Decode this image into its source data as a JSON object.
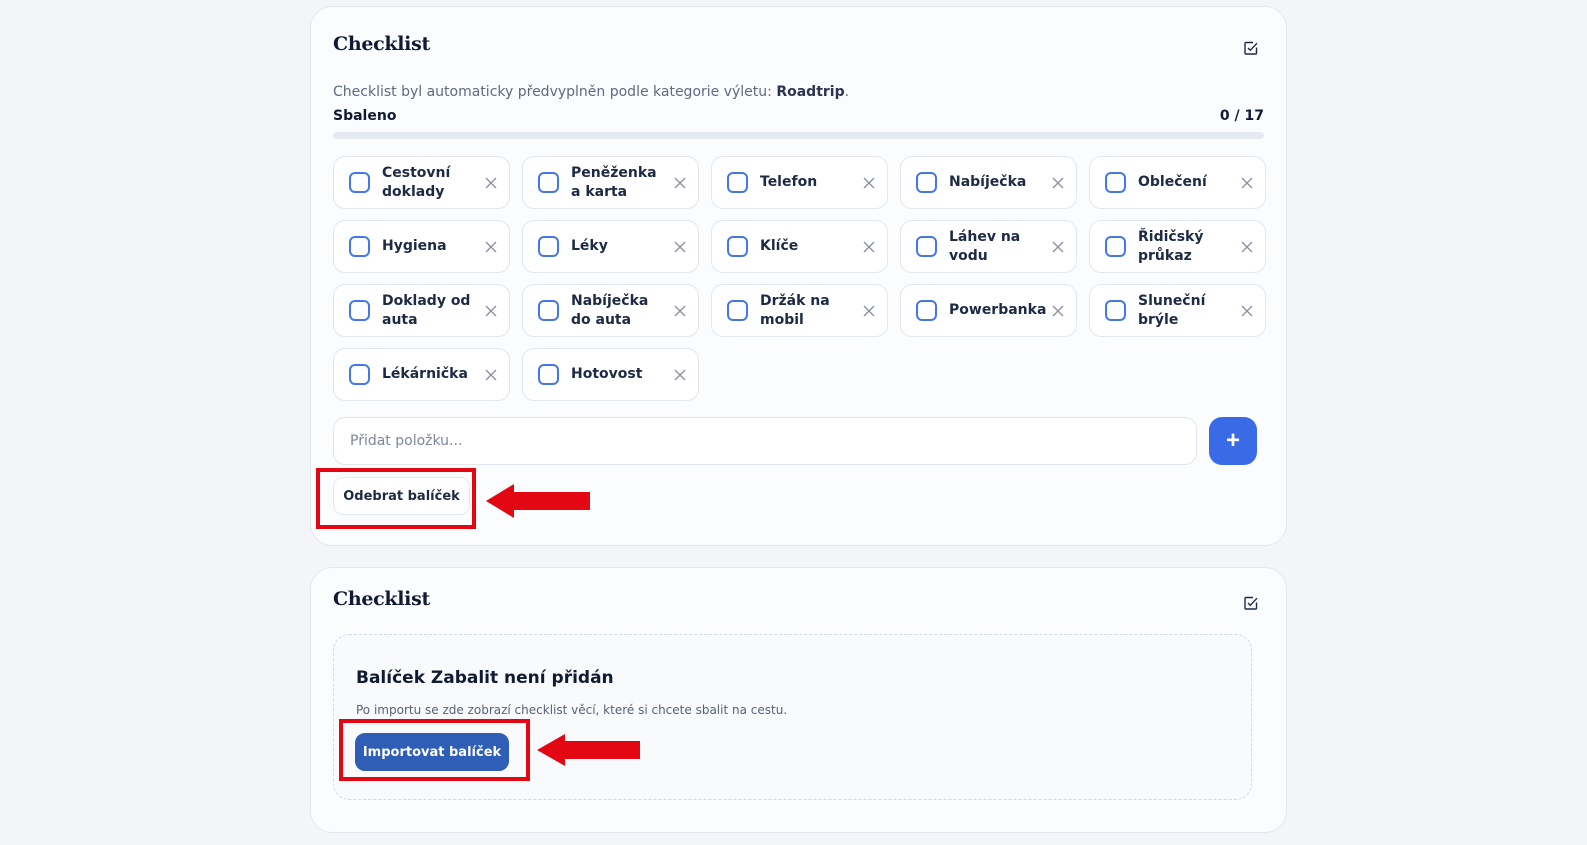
{
  "checklist_card": {
    "title": "Checklist",
    "info_prefix": "Checklist byl automaticky předvyplněn podle kategorie výletu: ",
    "info_category": "Roadtrip",
    "info_suffix": ".",
    "packed_label": "Sbaleno",
    "packed_count": "0 / 17",
    "progress": 0,
    "items": [
      {
        "label": "Cestovní doklady",
        "checked": false
      },
      {
        "label": "Peněženka a karta",
        "checked": false
      },
      {
        "label": "Telefon",
        "checked": false
      },
      {
        "label": "Nabíječka",
        "checked": false
      },
      {
        "label": "Oblečení",
        "checked": false
      },
      {
        "label": "Hygiena",
        "checked": false
      },
      {
        "label": "Léky",
        "checked": false
      },
      {
        "label": "Klíče",
        "checked": false
      },
      {
        "label": "Láhev na vodu",
        "checked": false
      },
      {
        "label": "Řidičský průkaz",
        "checked": false
      },
      {
        "label": "Doklady od auta",
        "checked": false
      },
      {
        "label": "Nabíječka do auta",
        "checked": false
      },
      {
        "label": "Držák na mobil",
        "checked": false
      },
      {
        "label": "Powerbanka",
        "checked": false
      },
      {
        "label": "Sluneční brýle",
        "checked": false
      },
      {
        "label": "Lékárnička",
        "checked": false
      },
      {
        "label": "Hotovost",
        "checked": false
      }
    ],
    "add_placeholder": "Přidat položku...",
    "add_button": "+",
    "remove_pack_button": "Odebrat balíček"
  },
  "empty_card": {
    "title": "Checklist",
    "empty_title": "Balíček Zabalit není přidán",
    "empty_desc": "Po importu se zde zobrazí checklist věcí, které si chcete sbalit na cestu.",
    "import_button": "Importovat balíček"
  },
  "colors": {
    "accent": "#3b6ae6",
    "import_button": "#2e5eb5",
    "annotation": "#e30613"
  },
  "icons": [
    "edit-checklist-icon",
    "close-icon",
    "plus-icon",
    "annotation-arrow"
  ]
}
